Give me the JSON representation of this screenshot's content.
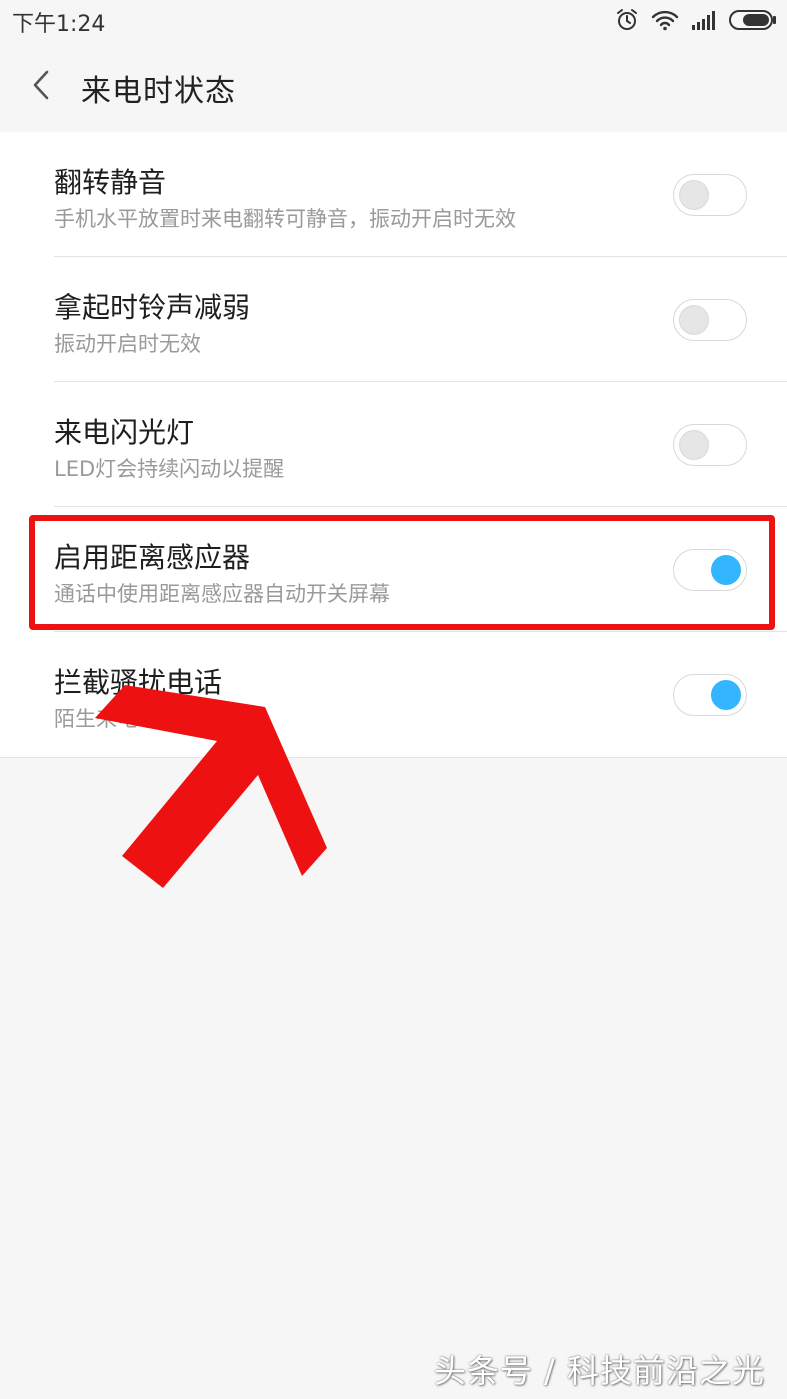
{
  "status_bar": {
    "time": "下午1:24",
    "icons": [
      "alarm-icon",
      "wifi-icon",
      "signal-icon",
      "battery-icon"
    ]
  },
  "header": {
    "back_icon": "chevron-left-icon",
    "title": "来电时状态"
  },
  "settings": [
    {
      "title": "翻转静音",
      "description": "手机水平放置时来电翻转可静音，振动开启时无效",
      "enabled": false
    },
    {
      "title": "拿起时铃声减弱",
      "description": "振动开启时无效",
      "enabled": false
    },
    {
      "title": "来电闪光灯",
      "description": "LED灯会持续闪动以提醒",
      "enabled": false
    },
    {
      "title": "启用距离感应器",
      "description": "通话中使用距离感应器自动开关屏幕",
      "enabled": true
    },
    {
      "title": "拦截骚扰电话",
      "description": "陌生来电响铃静音",
      "enabled": true
    }
  ],
  "annotation": {
    "highlighted_item": "启用距离感应器",
    "color": "#ee1111"
  },
  "colors": {
    "toggle_on": "#33b5ff",
    "toggle_off": "#e6e6e6"
  },
  "watermark": "头条号 / 科技前沿之光"
}
